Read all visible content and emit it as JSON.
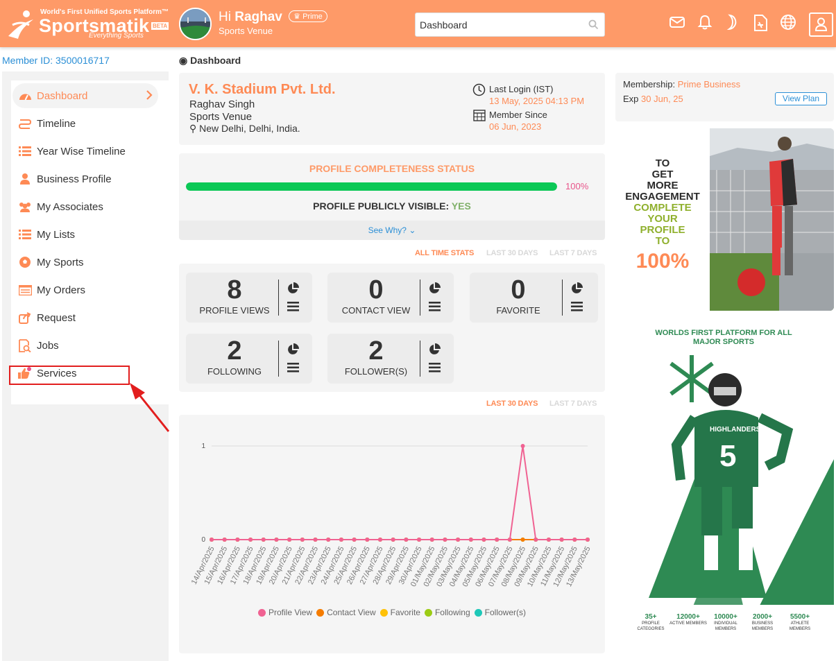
{
  "header": {
    "tagline": "World's First Unified Sports Platform™",
    "brand": "Sportsmatik",
    "beta": "BETA",
    "brand_sub": "Everything Sports",
    "greeting_prefix": "Hi",
    "user_name": "Raghav",
    "badge": "Prime",
    "user_type": "Sports Venue",
    "search_value": "Dashboard",
    "icons": [
      "mail-icon",
      "bell-icon",
      "moon-icon",
      "document-icon",
      "globe-icon",
      "user-icon"
    ]
  },
  "member_id": "Member ID: 3500016717",
  "breadcrumb": "Dashboard",
  "sidebar": {
    "items": [
      {
        "label": "Dashboard",
        "icon": "dashboard-icon",
        "active": true
      },
      {
        "label": "Timeline",
        "icon": "timeline-icon"
      },
      {
        "label": "Year Wise Timeline",
        "icon": "list-icon"
      },
      {
        "label": "Business Profile",
        "icon": "person-icon"
      },
      {
        "label": "My Associates",
        "icon": "people-icon"
      },
      {
        "label": "My Lists",
        "icon": "list-icon"
      },
      {
        "label": "My Sports",
        "icon": "ball-icon"
      },
      {
        "label": "My Orders",
        "icon": "orders-icon"
      },
      {
        "label": "Request",
        "icon": "request-icon"
      },
      {
        "label": "Jobs",
        "icon": "jobs-icon"
      },
      {
        "label": "Services",
        "icon": "thumbs-up-icon"
      }
    ]
  },
  "profile": {
    "name": "V. K. Stadium Pvt. Ltd.",
    "person": "Raghav Singh",
    "type": "Sports Venue",
    "location": "New Delhi, Delhi, India.",
    "last_login_label": "Last Login (IST)",
    "last_login": "13 May, 2025 04:13 PM",
    "member_since_label": "Member Since",
    "member_since": "06 Jun, 2023"
  },
  "completeness": {
    "title": "PROFILE COMPLETENESS STATUS",
    "percent_value": 100,
    "percent_label": "100%",
    "visible_label": "PROFILE PUBLICLY VISIBLE:",
    "visible_value": "YES",
    "see_why": "See Why?"
  },
  "stats_tabs": [
    "ALL TIME STATS",
    "LAST 30 DAYS",
    "LAST 7 DAYS"
  ],
  "stats": [
    {
      "value": "8",
      "label": "PROFILE VIEWS"
    },
    {
      "value": "0",
      "label": "CONTACT VIEW"
    },
    {
      "value": "0",
      "label": "FAVORITE"
    },
    {
      "value": "2",
      "label": "FOLLOWING"
    },
    {
      "value": "2",
      "label": "FOLLOWER(S)"
    }
  ],
  "chart_tabs": [
    "LAST 30 DAYS",
    "LAST 7 DAYS"
  ],
  "membership": {
    "label": "Membership:",
    "plan": "Prime Business",
    "exp_label": "Exp",
    "exp_date": "30 Jun, 25",
    "view_plan": "View Plan"
  },
  "promo": {
    "lines_dark": [
      "TO",
      "GET",
      "MORE",
      "ENGAGEMENT"
    ],
    "lines_green": [
      "COMPLETE",
      "YOUR",
      "PROFILE",
      "TO"
    ],
    "big": "100%"
  },
  "ad": {
    "title": "WORLDS FIRST PLATFORM FOR ALL MAJOR SPORTS",
    "jersey_number": "5",
    "jersey_text": "HIGHLANDERS",
    "stats": [
      {
        "n": "35+",
        "l": "PROFILE CATEGORIES"
      },
      {
        "n": "12000+",
        "l": "ACTIVE MEMBERS"
      },
      {
        "n": "10000+",
        "l": "INDIVIDUAL MEMBERS"
      },
      {
        "n": "2000+",
        "l": "BUSINESS MEMBERS"
      },
      {
        "n": "5500+",
        "l": "ATHLETE MEMBERS"
      }
    ]
  },
  "colors": {
    "accent": "#fe9a68",
    "accent_text": "#fe8a55",
    "link": "#2b8fd6",
    "progress": "#0bc856"
  },
  "chart_data": {
    "type": "line",
    "x": [
      "14/Apr/2025",
      "15/Apr/2025",
      "16/Apr/2025",
      "17/Apr/2025",
      "18/Apr/2025",
      "19/Apr/2025",
      "20/Apr/2025",
      "21/Apr/2025",
      "22/Apr/2025",
      "23/Apr/2025",
      "24/Apr/2025",
      "25/Apr/2025",
      "26/Apr/2025",
      "27/Apr/2025",
      "28/Apr/2025",
      "29/Apr/2025",
      "30/Apr/2025",
      "01/May/2025",
      "02/May/2025",
      "03/May/2025",
      "04/May/2025",
      "05/May/2025",
      "06/May/2025",
      "07/May/2025",
      "08/May/2025",
      "09/May/2025",
      "10/May/2025",
      "11/May/2025",
      "12/May/2025",
      "13/May/2025"
    ],
    "yticks": [
      "0",
      "1"
    ],
    "ylim": [
      0,
      1
    ],
    "series": [
      {
        "name": "Profile View",
        "color": "#f06292",
        "values": [
          0,
          0,
          0,
          0,
          0,
          0,
          0,
          0,
          0,
          0,
          0,
          0,
          0,
          0,
          0,
          0,
          0,
          0,
          0,
          0,
          0,
          0,
          0,
          0,
          1,
          0,
          0,
          0,
          0,
          0
        ]
      },
      {
        "name": "Contact View",
        "color": "#f57c00",
        "values": [
          0,
          0,
          0,
          0,
          0,
          0,
          0,
          0,
          0,
          0,
          0,
          0,
          0,
          0,
          0,
          0,
          0,
          0,
          0,
          0,
          0,
          0,
          0,
          0,
          0,
          0,
          0,
          0,
          0,
          0
        ]
      },
      {
        "name": "Favorite",
        "color": "#ffc107",
        "values": [
          0,
          0,
          0,
          0,
          0,
          0,
          0,
          0,
          0,
          0,
          0,
          0,
          0,
          0,
          0,
          0,
          0,
          0,
          0,
          0,
          0,
          0,
          0,
          0,
          0,
          0,
          0,
          0,
          0,
          0
        ]
      },
      {
        "name": "Following",
        "color": "#9ccc15",
        "values": [
          0,
          0,
          0,
          0,
          0,
          0,
          0,
          0,
          0,
          0,
          0,
          0,
          0,
          0,
          0,
          0,
          0,
          0,
          0,
          0,
          0,
          0,
          0,
          0,
          0,
          0,
          0,
          0,
          0,
          0
        ]
      },
      {
        "name": "Follower(s)",
        "color": "#1ec8b8",
        "values": [
          0,
          0,
          0,
          0,
          0,
          0,
          0,
          0,
          0,
          0,
          0,
          0,
          0,
          0,
          0,
          0,
          0,
          0,
          0,
          0,
          0,
          0,
          0,
          0,
          0,
          0,
          0,
          0,
          0,
          0
        ]
      }
    ],
    "grid": "horizontal",
    "legend": "bottom"
  }
}
